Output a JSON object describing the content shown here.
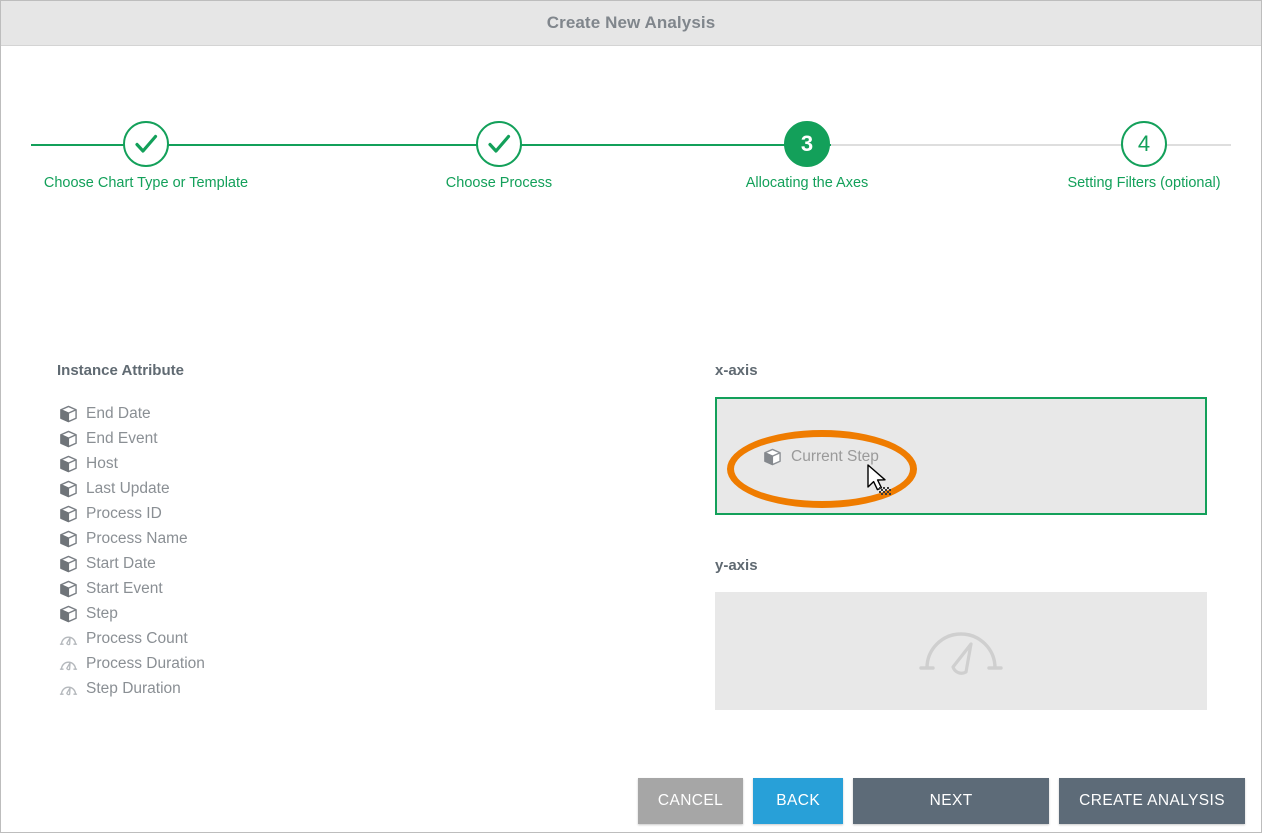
{
  "window": {
    "title": "Create New Analysis"
  },
  "stepper": {
    "steps": [
      {
        "number": "1",
        "label": "Choose Chart Type or Template",
        "state": "done",
        "icon": "check-icon"
      },
      {
        "number": "2",
        "label": "Choose Process",
        "state": "done",
        "icon": "check-icon"
      },
      {
        "number": "3",
        "label": "Allocating the Axes",
        "state": "current",
        "icon": "number-3"
      },
      {
        "number": "4",
        "label": "Setting Filters (optional)",
        "state": "upcoming",
        "icon": "number-4"
      }
    ],
    "accent_color": "#13a05a",
    "inactive_line_color": "#dedede"
  },
  "left_panel": {
    "heading": "Instance Attribute",
    "attributes": [
      {
        "label": "End Date",
        "icon": "cube-icon"
      },
      {
        "label": "End Event",
        "icon": "cube-icon"
      },
      {
        "label": "Host",
        "icon": "cube-icon"
      },
      {
        "label": "Last Update",
        "icon": "cube-icon"
      },
      {
        "label": "Process ID",
        "icon": "cube-icon"
      },
      {
        "label": "Process Name",
        "icon": "cube-icon"
      },
      {
        "label": "Start Date",
        "icon": "cube-icon"
      },
      {
        "label": "Start Event",
        "icon": "cube-icon"
      },
      {
        "label": "Step",
        "icon": "cube-icon"
      },
      {
        "label": "Process Count",
        "icon": "gauge-icon"
      },
      {
        "label": "Process Duration",
        "icon": "gauge-icon"
      },
      {
        "label": "Step Duration",
        "icon": "gauge-icon"
      }
    ]
  },
  "right_panel": {
    "x_axis": {
      "title": "x-axis",
      "chip_label": "Current Step",
      "chip_icon": "cube-icon",
      "highlighted": true,
      "border_color": "#13a05a"
    },
    "y_axis": {
      "title": "y-axis",
      "chip_label": "",
      "placeholder_icon": "gauge-icon",
      "highlighted": false
    }
  },
  "annotation": {
    "shape": "ellipse",
    "color": "#ef7c00",
    "target": "Current Step"
  },
  "cursor": {
    "type": "arrow-drag-cursor"
  },
  "footer": {
    "buttons": [
      {
        "label": "CANCEL",
        "color": "#a6a6a6"
      },
      {
        "label": "BACK",
        "color": "#28a0d8"
      },
      {
        "label": "NEXT",
        "color": "#5d6b78"
      },
      {
        "label": "CREATE ANALYSIS",
        "color": "#5d6b78"
      }
    ]
  }
}
